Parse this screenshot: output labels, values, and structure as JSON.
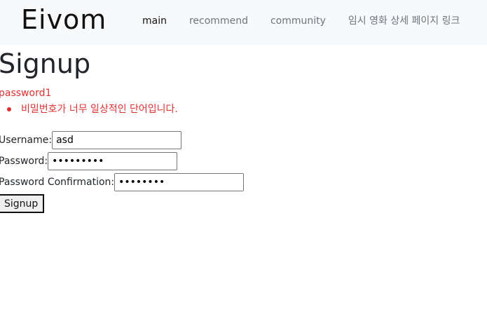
{
  "navbar": {
    "brand": "Eivom",
    "links": [
      {
        "label": "main",
        "active": true
      },
      {
        "label": "recommend",
        "active": false
      },
      {
        "label": "community",
        "active": false
      },
      {
        "label": "임시 영화 상세 페이지 링크",
        "active": false
      }
    ]
  },
  "page": {
    "title": "Signup"
  },
  "errors": {
    "field": "password1",
    "messages": [
      "비밀번호가 너무 일상적인 단어입니다."
    ]
  },
  "form": {
    "username_label": "Username:",
    "username_value": "asd",
    "password_label": "Password:",
    "password_mask": "•••••••••",
    "password_confirm_label": "Password Confirmation:",
    "password_confirm_mask": "••••••••",
    "submit_label": "Signup"
  },
  "colors": {
    "navbar_bg": "#f8f9fa",
    "error_text": "#e03030",
    "nav_link": "#6c757d",
    "nav_link_active": "#111111"
  }
}
